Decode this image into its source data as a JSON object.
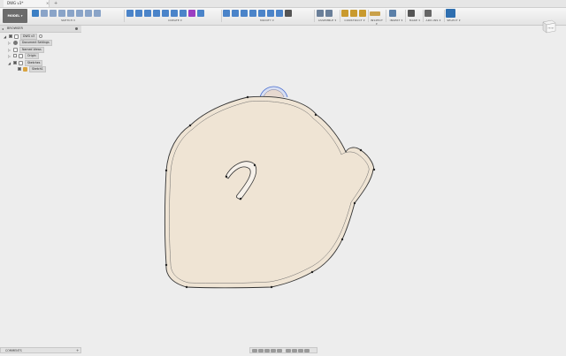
{
  "titlebar": {
    "doc_title": "DWG v3*",
    "close_glyph": "×",
    "add_glyph": "+"
  },
  "toolbar": {
    "workspace_label": "MODEL ▾",
    "groups": [
      {
        "label": "SKETCH ▾"
      },
      {
        "label": "CREATE ▾"
      },
      {
        "label": "MODIFY ▾"
      },
      {
        "label": "ASSEMBLE ▾"
      },
      {
        "label": "CONSTRUCT ▾"
      },
      {
        "label": "INSPECT ▾"
      },
      {
        "label": "INSERT ▾"
      },
      {
        "label": "MAKE ▾"
      },
      {
        "label": "ADD-INS ▾"
      },
      {
        "label": "SELECT ▾"
      }
    ]
  },
  "browser": {
    "title": "BROWSER",
    "collapse_glyph": "◂",
    "items": [
      {
        "label": "DWG v3",
        "expanded": true
      },
      {
        "label": "Document Settings",
        "expanded": false
      },
      {
        "label": "Named Views",
        "expanded": false
      },
      {
        "label": "Origin",
        "expanded": false
      },
      {
        "label": "Sketches",
        "expanded": true
      },
      {
        "label": "Sketch1",
        "expanded": false
      }
    ]
  },
  "viewcube": {
    "face_label": "FRONT"
  },
  "comments": {
    "label": "COMMENTS",
    "add_glyph": "+"
  },
  "colors": {
    "accent": "#1f6fb5",
    "profile_fill": "#efe4d4",
    "sketch_line": "#333333",
    "offset_line": "#6a6a6a",
    "arc_blue": "#4a6fd1",
    "canvas_bg": "#ededed"
  },
  "icons": {
    "toolbar": [
      "new-sketch-icon",
      "finish-sketch-icon",
      "line-icon",
      "rectangle-icon",
      "circle-icon",
      "arc-icon",
      "polygon-icon",
      "spline-icon",
      "trim-icon",
      "offset-icon",
      "mirror-icon",
      "extrude-icon",
      "revolve-icon",
      "sweep-icon",
      "loft-icon",
      "box-icon",
      "cylinder-icon",
      "sphere-icon",
      "press-pull-icon",
      "fillet-icon",
      "chamfer-icon",
      "shell-icon",
      "scale-icon",
      "combine-icon",
      "move-icon",
      "joint-icon",
      "rigid-group-icon",
      "offset-plane-icon",
      "plane-angle-icon",
      "axis-icon",
      "measure-icon",
      "insert-image-icon",
      "3d-print-icon",
      "scripts-icon",
      "select-icon"
    ]
  }
}
